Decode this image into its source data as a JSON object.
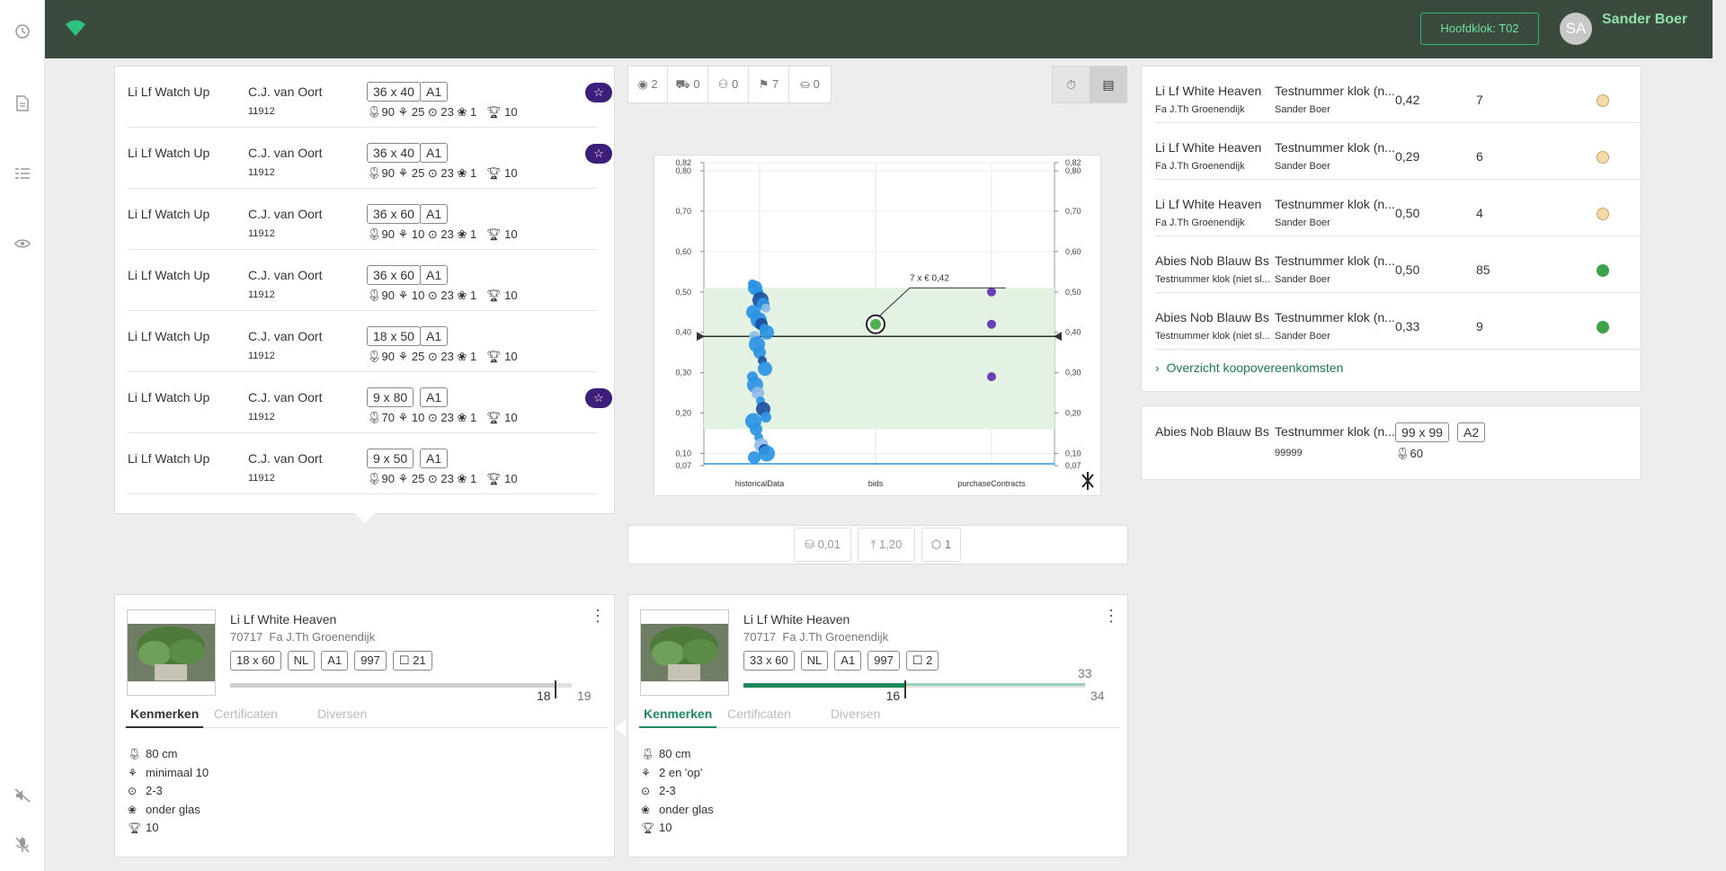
{
  "sidebar": {
    "icons": [
      "history-icon",
      "document-icon",
      "list-icon",
      "eye-icon",
      "sound-off-icon",
      "mic-off-icon"
    ]
  },
  "header": {
    "clock_button": "Hoofdklok:  T02",
    "avatar_initials": "SA",
    "user_name": "Sander Boer",
    "bg_color": "#3a4a3d",
    "accent": "#2eb876"
  },
  "lots": [
    {
      "name": "Li Lf Watch Up",
      "grower": "C.J. van Oort",
      "code": "11912",
      "size": "36 x 40",
      "grade": "A1",
      "specs": "🌷︎90 ⚘ 25 ⊙ 23 ❀ 1   🏆︎ 10",
      "starred": true
    },
    {
      "name": "Li Lf Watch Up",
      "grower": "C.J. van Oort",
      "code": "11912",
      "size": "36 x 40",
      "grade": "A1",
      "specs": "🌷︎90 ⚘ 25 ⊙ 23 ❀ 1   🏆︎ 10",
      "starred": true
    },
    {
      "name": "Li Lf Watch Up",
      "grower": "C.J. van Oort",
      "code": "11912",
      "size": "36 x 60",
      "grade": "A1",
      "specs": "🌷︎90 ⚘ 10 ⊙ 23 ❀ 1   🏆︎ 10",
      "starred": false
    },
    {
      "name": "Li Lf Watch Up",
      "grower": "C.J. van Oort",
      "code": "11912",
      "size": "36 x 60",
      "grade": "A1",
      "specs": "🌷︎90 ⚘ 10 ⊙ 23 ❀ 1   🏆︎ 10",
      "starred": false
    },
    {
      "name": "Li Lf Watch Up",
      "grower": "C.J. van Oort",
      "code": "11912",
      "size": "18 x 50",
      "grade": "A1",
      "specs": "🌷︎90 ⚘ 25 ⊙ 23 ❀ 1   🏆︎ 10",
      "starred": false
    },
    {
      "name": "Li Lf Watch Up",
      "grower": "C.J. van Oort",
      "code": "11912",
      "size": "9 x 80",
      "grade": "A1",
      "specs": "🌷︎70 ⚘ 10 ⊙ 23 ❀ 1   🏆︎ 10",
      "starred": true
    },
    {
      "name": "Li Lf Watch Up",
      "grower": "C.J. van Oort",
      "code": "11912",
      "size": "9 x 50",
      "grade": "A1",
      "specs": "🌷︎90 ⚘ 25 ⊙ 23 ❀ 1   🏆︎ 10",
      "starred": false
    }
  ],
  "stats_toolbar": {
    "views": "2",
    "cart": "0",
    "people": "0",
    "flags": "7",
    "basket": "0"
  },
  "chart_data": {
    "type": "scatter",
    "categories": [
      "historicalData",
      "bids",
      "purchaseContracts"
    ],
    "ylim": [
      0.07,
      0.82
    ],
    "yticks_left": [
      "0,82",
      "0,80",
      "0,70",
      "0,60",
      "0,50",
      "0,40",
      "0,30",
      "0,20",
      "0,10",
      "0,07"
    ],
    "yticks_right": [
      "0,82",
      "0,80",
      "0,70",
      "0,60",
      "0,50",
      "0,40",
      "0,30",
      "0,20",
      "0,10",
      "0,07"
    ],
    "band": [
      0.16,
      0.51
    ],
    "reference_line": 0.39,
    "bid": {
      "value": 0.42,
      "label": "7 x € 0,42"
    },
    "purchase_points": [
      0.5,
      0.42,
      0.29
    ],
    "historical_points": [
      0.52,
      0.51,
      0.5,
      0.48,
      0.47,
      0.46,
      0.45,
      0.44,
      0.43,
      0.42,
      0.41,
      0.4,
      0.39,
      0.37,
      0.35,
      0.33,
      0.31,
      0.29,
      0.27,
      0.25,
      0.23,
      0.21,
      0.19,
      0.18,
      0.16,
      0.14,
      0.12,
      0.11,
      0.1,
      0.09
    ],
    "colors": {
      "band": "#e3f2e3",
      "historical": "#2b94e4",
      "purchase": "#6b3fb5",
      "bid": "#4caf50",
      "line": "#2c2c2c"
    }
  },
  "bottom_toolbar": {
    "price_step": "0,01",
    "max": "1,20",
    "units": "1"
  },
  "contracts": [
    {
      "product": "Li Lf White Heaven",
      "grower": "Fa J.Th Groenendijk",
      "name": "Testnummer klok (n...",
      "user": "Sander Boer",
      "price": "0,42",
      "qty": "7",
      "status": "#f6d9a8"
    },
    {
      "product": "Li Lf White Heaven",
      "grower": "Fa J.Th Groenendijk",
      "name": "Testnummer klok (n...",
      "user": "Sander Boer",
      "price": "0,29",
      "qty": "6",
      "status": "#f6d9a8"
    },
    {
      "product": "Li Lf White Heaven",
      "grower": "Fa J.Th Groenendijk",
      "name": "Testnummer klok (n...",
      "user": "Sander Boer",
      "price": "0,50",
      "qty": "4",
      "status": "#f6d9a8"
    },
    {
      "product": "Abies Nob Blauw Bs",
      "grower": "Testnummer klok (niet sl...",
      "name": "Testnummer klok (n...",
      "user": "Sander Boer",
      "price": "0,50",
      "qty": "85",
      "status": "#3fa24a"
    },
    {
      "product": "Abies Nob Blauw Bs",
      "grower": "Testnummer klok (niet sl...",
      "name": "Testnummer klok (n...",
      "user": "Sander Boer",
      "price": "0,33",
      "qty": "9",
      "status": "#3fa24a"
    }
  ],
  "overview_link": "Overzicht koopovereenkomsten",
  "mini_card": {
    "product": "Abies Nob Blauw Bs",
    "name": "Testnummer klok (n...",
    "code": "99999",
    "size": "99 x 99",
    "grade": "A2",
    "spec": "60"
  },
  "cards": [
    {
      "title": "Li Lf White Heaven",
      "code": "70717",
      "grower": "Fa J.Th Groenendijk",
      "tags": [
        "18 x 60",
        "NL",
        "A1",
        "997",
        "☐ 21"
      ],
      "progress": {
        "current": "18",
        "total": "19",
        "fraction": 0.95,
        "color": "#cfcfcf",
        "above": ""
      },
      "tabs": [
        "Kenmerken",
        "Certificaten",
        "Diversen"
      ],
      "attrs": [
        {
          "icon": "stem-length-icon",
          "glyph": "🌷︎",
          "text": "80 cm"
        },
        {
          "icon": "branch-icon",
          "glyph": "⚘",
          "text": "minimaal 10"
        },
        {
          "icon": "ripeness-icon",
          "glyph": "⊙",
          "text": "2-3"
        },
        {
          "icon": "glass-icon",
          "glyph": "❀",
          "text": "onder glas"
        },
        {
          "icon": "quality-icon",
          "glyph": "🏆︎",
          "text": "10"
        }
      ]
    },
    {
      "title": "Li Lf White Heaven",
      "code": "70717",
      "grower": "Fa J.Th Groenendijk",
      "tags": [
        "33 x 60",
        "NL",
        "A1",
        "997",
        "☐ 2"
      ],
      "progress": {
        "current": "16",
        "total": "34",
        "fraction": 0.47,
        "color": "#1e8a5c",
        "above": "33"
      },
      "tabs": [
        "Kenmerken",
        "Certificaten",
        "Diversen"
      ],
      "attrs": [
        {
          "icon": "stem-length-icon",
          "glyph": "🌷︎",
          "text": "80 cm"
        },
        {
          "icon": "branch-icon",
          "glyph": "⚘",
          "text": "2 en 'op'"
        },
        {
          "icon": "ripeness-icon",
          "glyph": "⊙",
          "text": "2-3"
        },
        {
          "icon": "glass-icon",
          "glyph": "❀",
          "text": "onder glas"
        },
        {
          "icon": "quality-icon",
          "glyph": "🏆︎",
          "text": "10"
        }
      ]
    }
  ]
}
